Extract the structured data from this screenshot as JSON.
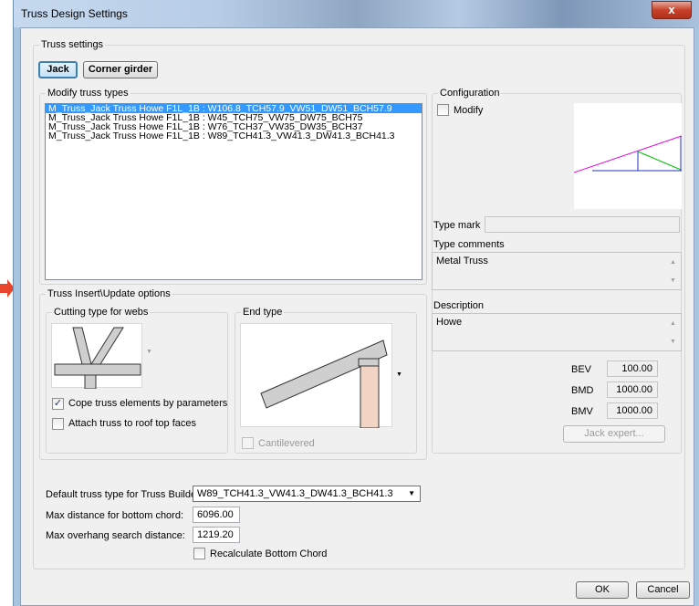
{
  "window": {
    "title": "Truss Design Settings",
    "close_label": "x"
  },
  "truss_settings": {
    "label": "Truss settings",
    "tabs": [
      {
        "label": "Jack"
      },
      {
        "label": "Corner girder"
      }
    ]
  },
  "modify_types": {
    "label": "Modify truss types",
    "items": [
      "M_Truss_Jack Truss Howe F1L_1B : W106.8_TCH57.9_VW51_DW51_BCH57.9",
      "M_Truss_Jack Truss Howe F1L_1B : W45_TCH75_VW75_DW75_BCH75",
      "M_Truss_Jack Truss Howe F1L_1B : W76_TCH37_VW35_DW35_BCH37",
      "M_Truss_Jack Truss Howe F1L_1B : W89_TCH41.3_VW41.3_DW41.3_BCH41.3"
    ]
  },
  "insert_options": {
    "label": "Truss Insert\\Update options",
    "cutting_label": "Cutting type for webs",
    "end_type_label": "End type",
    "cope_label": "Cope truss elements by parameters",
    "cope_checked": "✓",
    "attach_label": "Attach truss to roof top faces",
    "cantilevered_label": "Cantilevered"
  },
  "configuration": {
    "label": "Configuration",
    "modify_label": "Modify",
    "type_mark_label": "Type mark",
    "type_mark_value": "",
    "type_comments_label": "Type comments",
    "type_comments_value": "Metal Truss",
    "description_label": "Description",
    "description_value": "Howe",
    "params": [
      {
        "label": "BEV",
        "value": "100.00"
      },
      {
        "label": "BMD",
        "value": "1000.00"
      },
      {
        "label": "BMV",
        "value": "1000.00"
      }
    ],
    "jack_expert_label": "Jack expert..."
  },
  "bottom": {
    "default_type_label": "Default truss type for Truss Builder:",
    "default_type_value": "W89_TCH41.3_VW41.3_DW41.3_BCH41.3",
    "max_bottom_label": "Max distance for bottom chord:",
    "max_bottom_value": "6096.00",
    "max_overhang_label": "Max overhang search distance:",
    "max_overhang_value": "1219.20",
    "recalc_label": "Recalculate Bottom Chord"
  },
  "buttons": {
    "ok": "OK",
    "cancel": "Cancel"
  },
  "colors": {
    "selection": "#3399ff",
    "pointer_arrow": "#e8452c",
    "config_top_chord": "#e000e0",
    "config_web": "#00c000",
    "config_frame": "#2030c0"
  }
}
